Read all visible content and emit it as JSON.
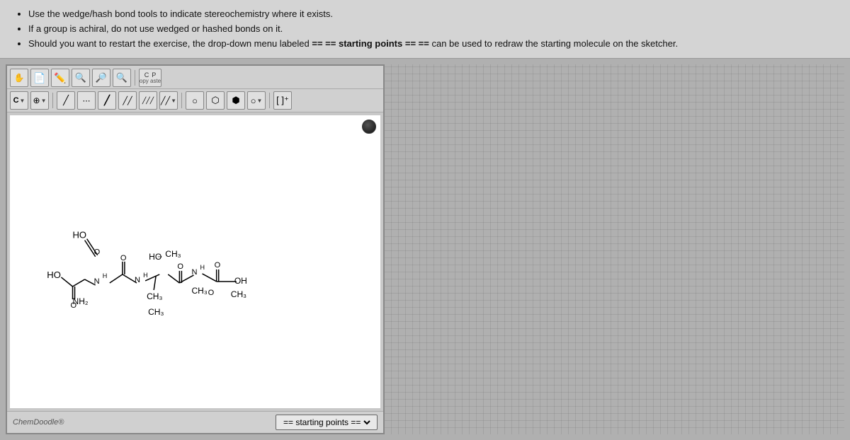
{
  "instructions": {
    "item1": "Use the wedge/hash bond tools to indicate stereochemistry where it exists.",
    "item2": "If a group is achiral, do not use wedged or hashed bonds on it.",
    "item3": "Should you want to restart the exercise, the drop-down menu labeled == starting points == can be used to redraw the starting molecule on the sketcher."
  },
  "toolbar": {
    "row1": {
      "tools": [
        "hand",
        "eraser",
        "lasso",
        "magnify",
        "zoom-in",
        "copy-paste"
      ]
    },
    "row2": {
      "tools": [
        "c-dropdown",
        "plus-dropdown",
        "single-bond",
        "dots-line",
        "single-bond2",
        "double-bond",
        "triple-bond",
        "bond-dropdown",
        "shapes1",
        "shapes2",
        "shapes3",
        "shapes4-dropdown",
        "bracket"
      ]
    }
  },
  "canvas": {
    "chemdoodle_label": "ChemDoodle®",
    "starting_points_label": "== starting points =="
  },
  "molecule": {
    "description": "Peptide chain molecule with HO, NH2, CH3 groups"
  }
}
